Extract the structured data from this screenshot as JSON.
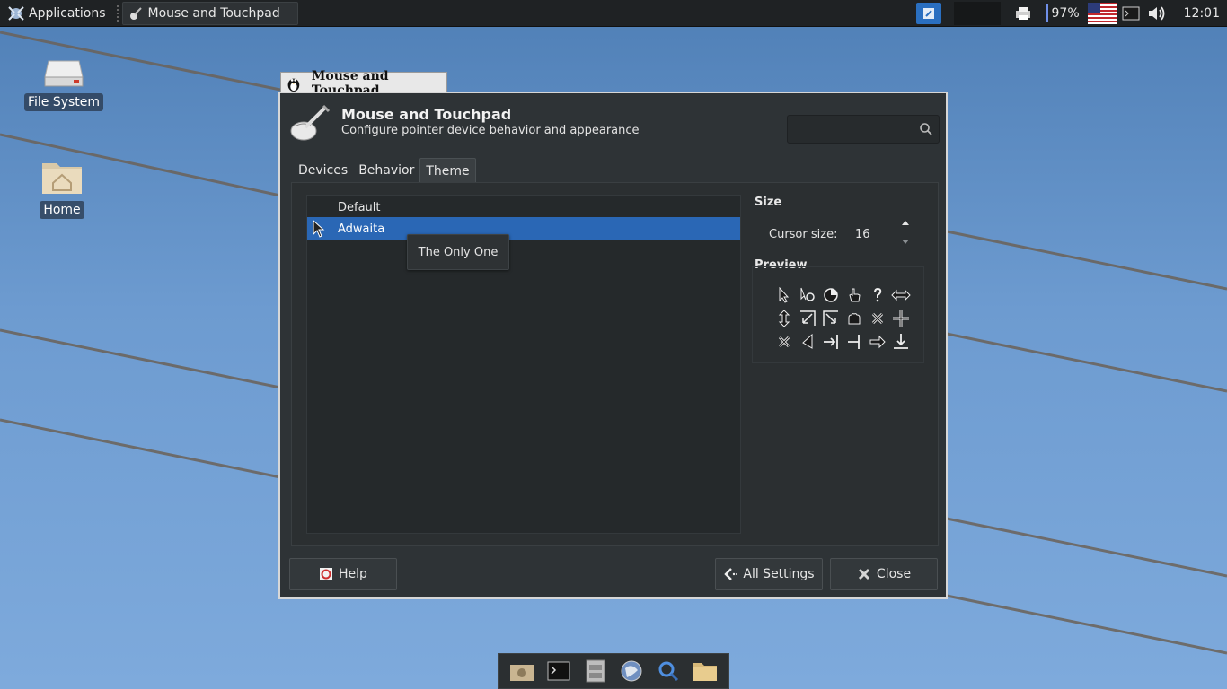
{
  "panel": {
    "applications_label": "Applications",
    "task_label": "Mouse and Touchpad",
    "battery": "97%",
    "clock": "12:01"
  },
  "desktop": {
    "icons": [
      {
        "label": "File System",
        "icon": "drive-icon"
      },
      {
        "label": "Home",
        "icon": "home-folder-icon"
      }
    ]
  },
  "window": {
    "tab_title": "Mouse and Touchpad",
    "title": "Mouse and Touchpad",
    "subtitle": "Configure pointer device behavior and appearance",
    "search_placeholder": "",
    "tabs": [
      {
        "label": "Devices",
        "active": false
      },
      {
        "label": "Behavior",
        "active": false
      },
      {
        "label": "Theme",
        "active": true
      }
    ],
    "themes": [
      {
        "name": "Default",
        "selected": false
      },
      {
        "name": "Adwaita",
        "selected": true
      }
    ],
    "tooltip": "The Only One",
    "size_section": "Size",
    "cursor_size_label": "Cursor size:",
    "cursor_size_value": "16",
    "preview_section": "Preview",
    "buttons": {
      "help": "Help",
      "all_settings": "All Settings",
      "close": "Close"
    }
  },
  "dock": {
    "items": [
      "camera-icon",
      "terminal-icon",
      "file-manager-icon",
      "browser-icon",
      "search-icon",
      "folder-icon"
    ]
  },
  "colors": {
    "selection": "#2a67b5",
    "window_bg": "#2e3336",
    "panel_bg": "#1f2224"
  }
}
